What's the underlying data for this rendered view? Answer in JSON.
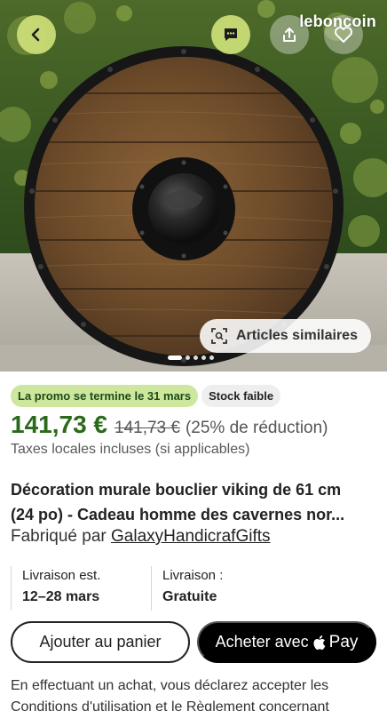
{
  "watermark": "leboncoin",
  "gallery": {
    "similar_label": "Articles similaires",
    "dots": 5,
    "active_dot": 0
  },
  "badges": {
    "promo": "La promo se termine le 31 mars",
    "stock": "Stock faible"
  },
  "price": {
    "current": "141,73 €",
    "original": "141,73 €",
    "discount": "(25% de réduction)",
    "taxes": "Taxes locales incluses (si applicables)"
  },
  "product": {
    "title_line1": "Décoration murale bouclier viking de 61 cm",
    "title_line2": "(24 po) - Cadeau homme des cavernes nor...",
    "made_by_prefix": "Fabriqué par ",
    "shop": "GalaxyHandicrafGifts"
  },
  "delivery": {
    "est_label": "Livraison est.",
    "est_value": "12–28 mars",
    "shipping_label": "Livraison :",
    "shipping_value": "Gratuite"
  },
  "actions": {
    "add_to_cart": "Ajouter au panier",
    "buy_with_prefix": "Acheter avec",
    "pay_label": "Pay"
  },
  "legal": {
    "line1": "En effectuant un achat, vous déclarez accepter les",
    "line2": "Conditions d'utilisation et le Règlement concernant"
  },
  "colors": {
    "accent_button": "#cde078",
    "price_green": "#2b6a1a",
    "promo_badge_bg": "#cde79e"
  }
}
